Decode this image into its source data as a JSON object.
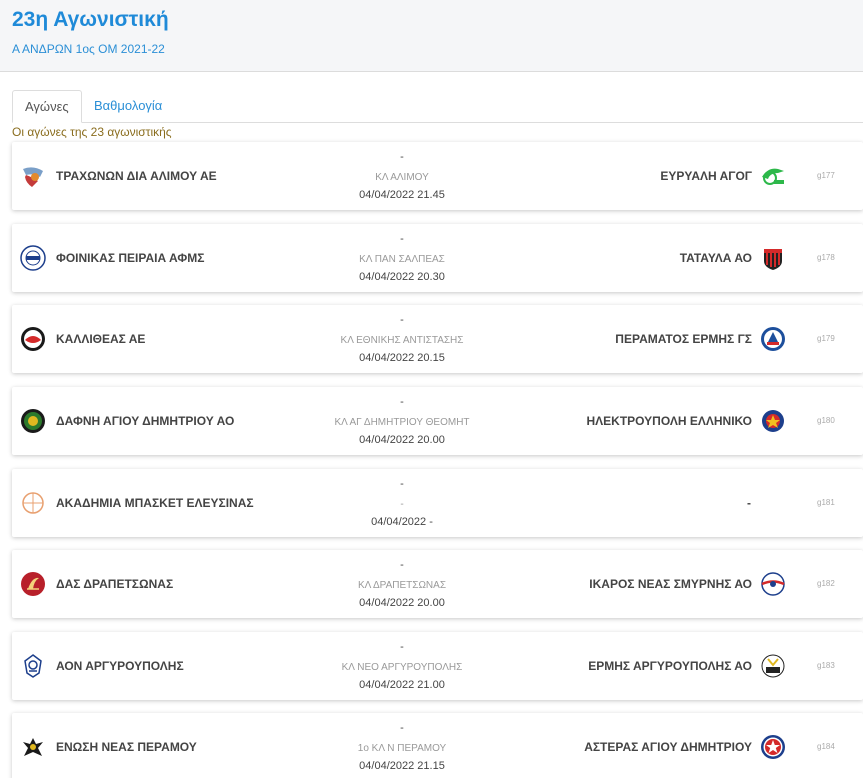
{
  "header": {
    "title": "23η Αγωνιστική",
    "subtitle": "Α ΑΝΔΡΩΝ 1ος ΟΜ 2021-22"
  },
  "tabs": [
    {
      "label": "Αγώνες"
    },
    {
      "label": "Βαθμολογία"
    }
  ],
  "round_label": "Οι αγώνες της 23 αγωνιστικής",
  "matches": [
    {
      "home": "ΤΡΑΧΩΝΩΝ ΔΙΑ ΑΛΙΜΟΥ ΑΕ",
      "score": "-",
      "venue": "ΚΛ ΑΛΙΜΟΥ",
      "datetime": "04/04/2022 21.45",
      "away": "ΕΥΡΥΑΛΗ ΑΓΟΓ",
      "id": "g177"
    },
    {
      "home": "ΦΟΙΝΙΚΑΣ ΠΕΙΡΑΙΑ ΑΦΜΣ",
      "score": "-",
      "venue": "ΚΛ ΠΑΝ ΣΑΛΠΕΑΣ",
      "datetime": "04/04/2022 20.30",
      "away": "ΤΑΤΑΥΛΑ ΑΟ",
      "id": "g178"
    },
    {
      "home": "ΚΑΛΛΙΘΕΑΣ ΑΕ",
      "score": "-",
      "venue": "ΚΛ ΕΘΝΙΚΗΣ ΑΝΤΙΣΤΑΣΗΣ",
      "datetime": "04/04/2022 20.15",
      "away": "ΠΕΡΑΜΑΤΟΣ ΕΡΜΗΣ ΓΣ",
      "id": "g179"
    },
    {
      "home": "ΔΑΦΝΗ ΑΓΙΟΥ ΔΗΜΗΤΡΙΟΥ ΑΟ",
      "score": "-",
      "venue": "ΚΛ ΑΓ ΔΗΜΗΤΡΙΟΥ ΘΕΟΜΗΤ",
      "datetime": "04/04/2022 20.00",
      "away": "ΗΛΕΚΤΡΟΥΠΟΛΗ ΕΛΛΗΝΙΚΟ",
      "id": "g180"
    },
    {
      "home": "ΑΚΑΔΗΜΙΑ ΜΠΑΣΚΕΤ ΕΛΕΥΣΙΝΑΣ",
      "score": "-",
      "venue": "-",
      "datetime": "04/04/2022 -",
      "away": "-",
      "id": "g181"
    },
    {
      "home": "ΔΑΣ ΔΡΑΠΕΤΣΩΝΑΣ",
      "score": "-",
      "venue": "ΚΛ ΔΡΑΠΕΤΣΩΝΑΣ",
      "datetime": "04/04/2022 20.00",
      "away": "ΙΚΑΡΟΣ ΝΕΑΣ ΣΜΥΡΝΗΣ ΑΟ",
      "id": "g182"
    },
    {
      "home": "ΑΟΝ ΑΡΓΥΡΟΥΠΟΛΗΣ",
      "score": "-",
      "venue": "ΚΛ ΝΕΟ ΑΡΓΥΡΟΥΠΟΛΗΣ",
      "datetime": "04/04/2022 21.00",
      "away": "ΕΡΜΗΣ ΑΡΓΥΡΟΥΠΟΛΗΣ ΑΟ",
      "id": "g183"
    },
    {
      "home": "ΕΝΩΣΗ ΝΕΑΣ ΠΕΡΑΜΟΥ",
      "score": "-",
      "venue": "1ο ΚΛ Ν ΠΕΡΑΜΟΥ",
      "datetime": "04/04/2022 21.15",
      "away": "ΑΣΤΕΡΑΣ ΑΓΙΟΥ ΔΗΜΗΤΡΙΟΥ",
      "id": "g184"
    }
  ],
  "colors": {
    "accent": "#1f8ad8",
    "round_label": "#8a6d1e"
  }
}
